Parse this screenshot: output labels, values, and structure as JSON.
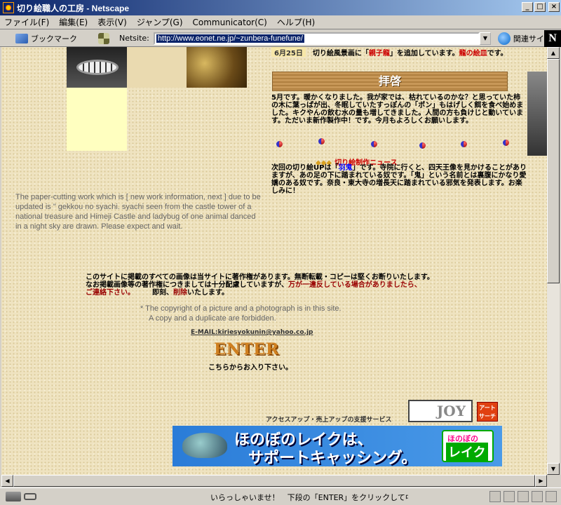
{
  "window": {
    "title": "切り絵職人の工房 - Netscape",
    "buttons": [
      "_",
      "□",
      "×"
    ]
  },
  "menu": [
    "ファイル(F)",
    "編集(E)",
    "表示(V)",
    "ジャンプ(G)",
    "Communicator(C)",
    "ヘルプ(H)"
  ],
  "location": {
    "bookmarks_label": "ブックマーク",
    "netsite_label": "Netsite:",
    "url": "http://www.eonet.ne.jp/~zunbera-funefune/",
    "related_label": "関連サイト",
    "logo": "N"
  },
  "page": {
    "news_date": "6月25日",
    "news_update_pre": "切り絵風景画に「",
    "news_update_item": "親子龍",
    "news_update_post": "」を追加しています。",
    "news_update_tail": "龍の絵皿",
    "news_update_tail2": "です。",
    "haikei": "拝啓",
    "letter": "5月です。暖かくなりました。我が家では、枯れているのかな？と思っていた柿の木に葉っぱが出、冬眠していたすっぽんの「ポン」もはげしく餌を食べ始めました。キクやんの飲む水の量も増してきました。人間の方も負けじと動いています。ただいま新作製作中！です。今月もよろしくお願いします。",
    "news_title": "切り絵制作ニュース",
    "news_ornament": "◆◆◆",
    "news_body_pre": "次回の切り絵UPは「",
    "news_body_item": "羽鬼",
    "news_body_post": "」です。寺院に行くと、四天王像を見かけることがありますが、あの足の下に踏まれている奴です。「鬼」という名前とは裏腹にかなり愛嬌のある奴です。奈良・東大寺の増長天に踏まれている邪気を発表します。お楽しみに！",
    "english": "The paper-cutting work which is [ new work information, next ] due to be updated is \" gekkou no syachi. syachi seen from the castle tower of a national treasure and Himeji Castle and ladybug of one animal danced in a night sky are drawn. Please expect and wait.",
    "copyright_jp_1": "このサイトに掲載のすべての画像は当サイトに著作権があります。無断転載・コピーは堅くお断りいたします。",
    "copyright_jp_2": "なお掲載画像等の著作権につきましては十分配慮していますが、",
    "copyright_jp_3": "万が一違反している場合がありましたら、",
    "copyright_jp_4": "ご連絡下さい。",
    "copyright_jp_5": "即刻、",
    "copyright_jp_6": "削除",
    "copyright_jp_7": "いたします。",
    "copyright_en_1": "* The copyright of a picture and a photograph is in this site.",
    "copyright_en_2": "A copy and a duplicate are forbidden.",
    "email": "E-MAIL:kiriesyokunin@yahoo.co.jp",
    "enter_logo": "ENTER",
    "enter_caption": "こちらからお入り下さい。",
    "access": "アクセスアップ・売上アップの支援サービス",
    "joy_logo": "JOY",
    "art_badge": "アート サーチ",
    "banner_line1": "ほのぼのレイクは、",
    "banner_line2": "サポートキャッシング。",
    "banner_badge_1": "ほのぼの",
    "banner_badge_2": "レイク"
  },
  "status": {
    "text": "いらっしゃいませ！　下段の「ENTER」をクリックして中にお入りください"
  },
  "colors": {
    "title_bar": "#0a246a",
    "accent_red": "#cc0000",
    "link_blue": "#0000ff"
  }
}
